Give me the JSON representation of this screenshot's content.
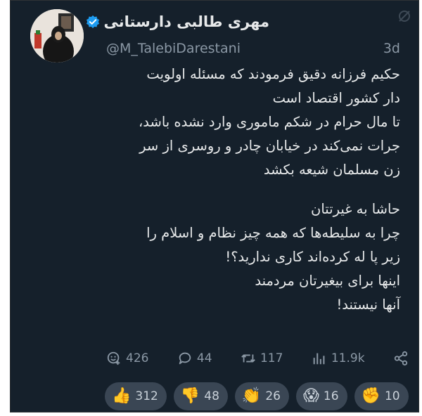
{
  "user": {
    "name": "مهری طالبی دارستانی",
    "handle": "@M_TalebiDarestani",
    "time": "3d"
  },
  "tweet": {
    "lines": [
      "حکیم فرزانه دقیق فرمودند که مسئله اولویت",
      "دار کشور اقتصاد است",
      "تا مال حرام در شکم ماموری وارد نشده باشد،",
      "جرات نمی‌کند در خیابان چادر و روسری از سر",
      "زن مسلمان شیعه بکشد",
      "",
      "حاشا به غیرتتان",
      "چرا به سلیطه‌ها که همه چیز نظام و اسلام را",
      "زیر پا له کرده‌اند کاری ندارید؟!",
      "اینها برای بیغیرتان مردمند",
      "آنها نیستند!"
    ]
  },
  "actions": {
    "reply_count": "426",
    "comment_count": "44",
    "retweet_count": "117",
    "views": "11.9k",
    "icons": [
      "reply-icon",
      "comment-icon",
      "retweet-icon",
      "views-icon",
      "share-icon"
    ]
  },
  "reactions": [
    {
      "emoji": "👍",
      "count": "312",
      "icon": "thumbs-up-icon"
    },
    {
      "emoji": "👎",
      "count": "48",
      "icon": "thumbs-down-icon"
    },
    {
      "emoji": "👏",
      "count": "26",
      "icon": "clapping-icon"
    },
    {
      "emoji": "😱",
      "count": "16",
      "icon": "scream-icon"
    },
    {
      "emoji": "✊",
      "count": "10",
      "icon": "fist-icon"
    }
  ],
  "colors": {
    "background": "#15202b",
    "verified": "#1d9bf0",
    "text": "#e7e9ea",
    "muted": "#8b98a5",
    "pill": "#3a4654"
  }
}
